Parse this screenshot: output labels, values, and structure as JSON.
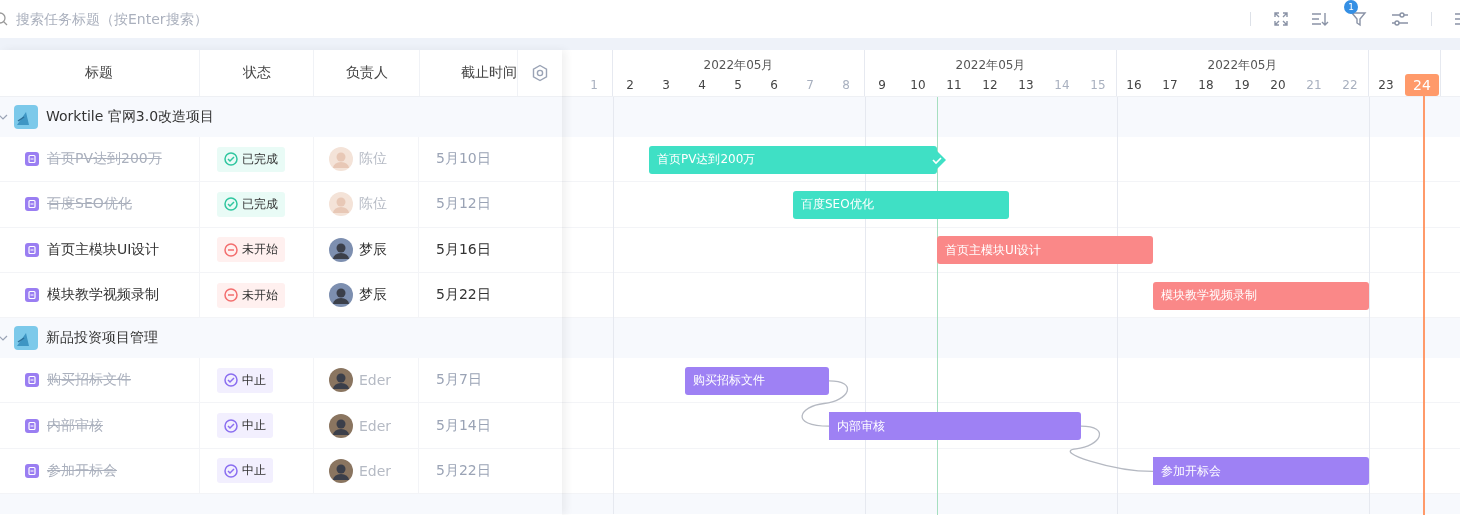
{
  "search": {
    "placeholder": "搜索任务标题（按Enter搜索）",
    "filter_badge": "1"
  },
  "columns": [
    "标题",
    "状态",
    "负责人",
    "截止时间"
  ],
  "timeline": {
    "weeks": [
      {
        "days": [
          {
            "label": "1",
            "weekend": true,
            "today": false
          }
        ]
      },
      {
        "month": "2022年05月",
        "days": [
          {
            "label": "2",
            "weekend": false,
            "today": false
          },
          {
            "label": "3",
            "weekend": false,
            "today": false
          },
          {
            "label": "4",
            "weekend": false,
            "today": false
          },
          {
            "label": "5",
            "weekend": false,
            "today": false
          },
          {
            "label": "6",
            "weekend": false,
            "today": false
          },
          {
            "label": "7",
            "weekend": true,
            "today": false
          },
          {
            "label": "8",
            "weekend": true,
            "today": false
          }
        ]
      },
      {
        "month": "2022年05月",
        "days": [
          {
            "label": "9",
            "weekend": false,
            "today": false
          },
          {
            "label": "10",
            "weekend": false,
            "today": false
          },
          {
            "label": "11",
            "weekend": false,
            "today": false
          },
          {
            "label": "12",
            "weekend": false,
            "today": false
          },
          {
            "label": "13",
            "weekend": false,
            "today": false
          },
          {
            "label": "14",
            "weekend": true,
            "today": false
          },
          {
            "label": "15",
            "weekend": true,
            "today": false
          }
        ]
      },
      {
        "month": "2022年05月",
        "days": [
          {
            "label": "16",
            "weekend": false,
            "today": false
          },
          {
            "label": "17",
            "weekend": false,
            "today": false
          },
          {
            "label": "18",
            "weekend": false,
            "today": false
          },
          {
            "label": "19",
            "weekend": false,
            "today": false
          },
          {
            "label": "20",
            "weekend": false,
            "today": false
          },
          {
            "label": "21",
            "weekend": true,
            "today": false
          },
          {
            "label": "22",
            "weekend": true,
            "today": false
          }
        ]
      },
      {
        "days": [
          {
            "label": "23",
            "weekend": false,
            "today": false
          },
          {
            "label": "24",
            "weekend": false,
            "today": true
          }
        ]
      }
    ]
  },
  "groups": [
    {
      "title": "Worktile 官网3.0改造项目",
      "expanded": true,
      "tasks": [
        {
          "title": "首页PV达到200万",
          "status": "已完成",
          "kind": "done",
          "assignee": "陈位",
          "due": "5月10日",
          "bar_label": "首页PV达到200万",
          "checked": true,
          "depends_on_previous": false
        },
        {
          "title": "百度SEO优化",
          "status": "已完成",
          "kind": "done",
          "assignee": "陈位",
          "due": "5月12日",
          "bar_label": "百度SEO优化",
          "checked": false,
          "depends_on_previous": false
        },
        {
          "title": "首页主模块UI设计",
          "status": "未开始",
          "kind": "todo",
          "assignee": "梦辰",
          "due": "5月16日",
          "bar_label": "首页主模块UI设计",
          "checked": false,
          "depends_on_previous": false
        },
        {
          "title": "模块教学视频录制",
          "status": "未开始",
          "kind": "todo",
          "assignee": "梦辰",
          "due": "5月22日",
          "bar_label": "模块教学视频录制",
          "checked": false,
          "depends_on_previous": false
        }
      ]
    },
    {
      "title": "新品投资项目管理",
      "expanded": true,
      "tasks": [
        {
          "title": "购买招标文件",
          "status": "中止",
          "kind": "stopped",
          "assignee": "Eder",
          "due": "5月7日",
          "bar_label": "购买招标文件",
          "checked": false,
          "depends_on_previous": false
        },
        {
          "title": "内部审核",
          "status": "中止",
          "kind": "stopped",
          "assignee": "Eder",
          "due": "5月14日",
          "bar_label": "内部审核",
          "checked": false,
          "depends_on_previous": true
        },
        {
          "title": "参加开标会",
          "status": "中止",
          "kind": "stopped",
          "assignee": "Eder",
          "due": "5月22日",
          "bar_label": "参加开标会",
          "checked": false,
          "depends_on_previous": true
        }
      ]
    }
  ]
}
